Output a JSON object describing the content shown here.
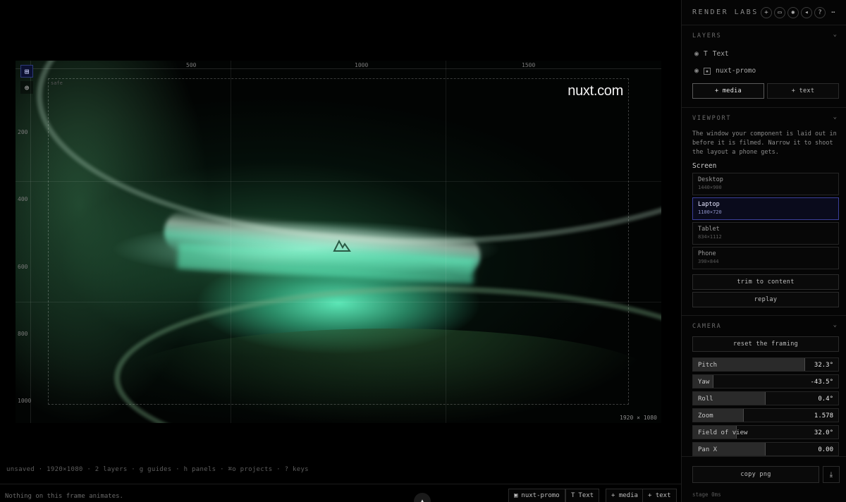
{
  "canvas": {
    "watermark": "nuxt.com",
    "frame_size": "1920 × 1080",
    "ruler_x": [
      "500",
      "1000",
      "1500"
    ],
    "ruler_y": [
      "200",
      "400",
      "600",
      "800",
      "1000"
    ],
    "safe_label": "safe"
  },
  "status": {
    "line": "unsaved · 1920×1080 · 2 layers · g guides · h panels · ⌘o projects · ? keys",
    "message": "Nothing on this frame animates."
  },
  "bottom_chips": {
    "media_layer": "nuxt-promo",
    "text_layer": "Text",
    "add_media": "+ media",
    "add_text": "+ text"
  },
  "panel": {
    "brand": "RENDER LABS",
    "layers": {
      "title": "LAYERS",
      "items": [
        {
          "label": "Text",
          "type_icon": "text-icon"
        },
        {
          "label": "nuxt-promo",
          "type_icon": "image-icon"
        }
      ],
      "add_media": "+ media",
      "add_text": "+ text"
    },
    "viewport": {
      "title": "VIEWPORT",
      "description": "The window your component is laid out in before it is filmed. Narrow it to shoot the layout a phone gets.",
      "screen_label": "Screen",
      "options": [
        {
          "name": "Desktop",
          "size": "1440×900"
        },
        {
          "name": "Laptop",
          "size": "1100×720"
        },
        {
          "name": "Tablet",
          "size": "834×1112"
        },
        {
          "name": "Phone",
          "size": "390×844"
        }
      ],
      "selected": "Laptop",
      "trim": "trim to content",
      "replay": "replay"
    },
    "camera": {
      "title": "CAMERA",
      "reset": "reset the framing",
      "sliders": [
        {
          "name": "Pitch",
          "value": "32.3°",
          "fill": 0.77
        },
        {
          "name": "Yaw",
          "value": "-43.5°",
          "fill": 0.14
        },
        {
          "name": "Roll",
          "value": "0.4°",
          "fill": 0.5
        },
        {
          "name": "Zoom",
          "value": "1.578",
          "fill": 0.35
        },
        {
          "name": "Field of view",
          "value": "32.0°",
          "fill": 0.3
        },
        {
          "name": "Pan X",
          "value": "0.00",
          "fill": 0.5
        }
      ]
    },
    "copy_png": "copy png",
    "stage_info": "stage 0ms"
  },
  "colors": {
    "accent": "#3b3f9a",
    "glow": "#5ff0be"
  }
}
